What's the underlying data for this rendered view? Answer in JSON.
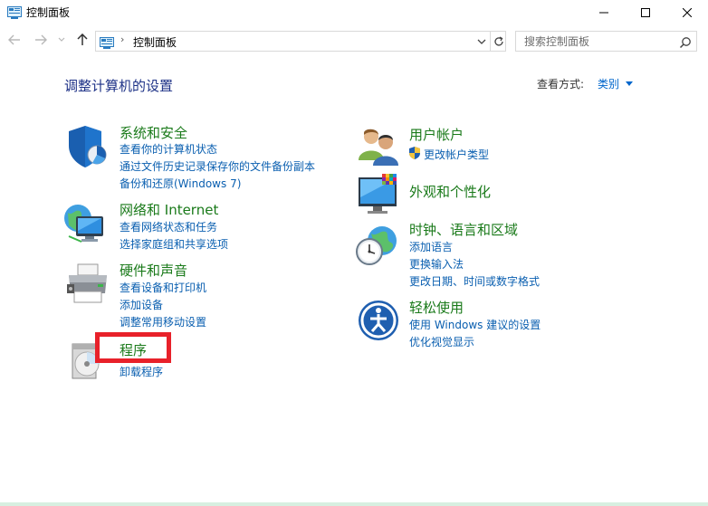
{
  "window": {
    "title": "控制面板"
  },
  "address": {
    "path": "控制面板",
    "separator": "›"
  },
  "search": {
    "placeholder": "搜索控制面板"
  },
  "header": {
    "title": "调整计算机的设置",
    "view_by_label": "查看方式:",
    "view_by_value": "类别"
  },
  "categories": {
    "security": {
      "title": "系统和安全",
      "links": [
        "查看你的计算机状态",
        "通过文件历史记录保存你的文件备份副本",
        "备份和还原(Windows 7)"
      ]
    },
    "network": {
      "title": "网络和 Internet",
      "links": [
        "查看网络状态和任务",
        "选择家庭组和共享选项"
      ]
    },
    "hardware": {
      "title": "硬件和声音",
      "links": [
        "查看设备和打印机",
        "添加设备",
        "调整常用移动设置"
      ]
    },
    "programs": {
      "title": "程序",
      "links": [
        "卸载程序"
      ]
    },
    "users": {
      "title": "用户帐户",
      "links": [
        "更改帐户类型"
      ]
    },
    "appearance": {
      "title": "外观和个性化",
      "links": []
    },
    "clock": {
      "title": "时钟、语言和区域",
      "links": [
        "添加语言",
        "更换输入法",
        "更改日期、时间或数字格式"
      ]
    },
    "ease": {
      "title": "轻松使用",
      "links": [
        "使用 Windows 建议的设置",
        "优化视觉显示"
      ]
    }
  },
  "colors": {
    "category_title": "#1a7a1a",
    "link": "#0a5fb0",
    "heading": "#1e3287",
    "highlight": "#e8212a"
  }
}
